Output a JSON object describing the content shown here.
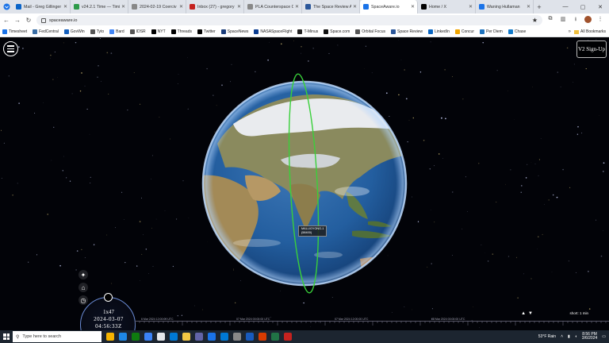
{
  "browser": {
    "tabs": [
      {
        "title": "Mail - Greg Gillinger",
        "color": "#0a64c8"
      },
      {
        "title": "v24.2.1 Time — Timi",
        "color": "#2e9b4a"
      },
      {
        "title": "2024-02-19 Coerciv",
        "color": "#888888"
      },
      {
        "title": "Inbox (27) - gregory",
        "color": "#c5221f"
      },
      {
        "title": "PLA Counterspace C",
        "color": "#888888"
      },
      {
        "title": "The Space Review A",
        "color": "#2b579a"
      },
      {
        "title": "SpaceAware.io",
        "color": "#1a73e8",
        "active": true
      },
      {
        "title": "Home / X",
        "color": "#000000"
      },
      {
        "title": "Waning Hullaman",
        "color": "#1a73e8"
      }
    ],
    "address": "spaceaware.io",
    "bookmarks": [
      {
        "label": "Timesheet",
        "color": "#1a73e8"
      },
      {
        "label": "FedCentral",
        "color": "#3a6ea5"
      },
      {
        "label": "GovWin",
        "color": "#1560bd"
      },
      {
        "label": "Tyto",
        "color": "#555555"
      },
      {
        "label": "Bard",
        "color": "#4285f4"
      },
      {
        "label": "IDSR",
        "color": "#555555"
      },
      {
        "label": "NYT",
        "color": "#000000"
      },
      {
        "label": "Threads",
        "color": "#000000"
      },
      {
        "label": "Twitter",
        "color": "#000000"
      },
      {
        "label": "SpaceNews",
        "color": "#1a3c7a"
      },
      {
        "label": "NASASpaceFlight",
        "color": "#0b3d91"
      },
      {
        "label": "T-Minus",
        "color": "#222222"
      },
      {
        "label": "Space.com",
        "color": "#111111"
      },
      {
        "label": "Orbital Focus",
        "color": "#555555"
      },
      {
        "label": "Space Review",
        "color": "#2b579a"
      },
      {
        "label": "LinkedIn",
        "color": "#0a66c2"
      },
      {
        "label": "Concur",
        "color": "#f0a500"
      },
      {
        "label": "Per Diem",
        "color": "#1e73be"
      },
      {
        "label": "Chase",
        "color": "#117aca"
      }
    ],
    "more_label": "»",
    "all_bookmarks_label": "All Bookmarks"
  },
  "app": {
    "signup_label": "V2 Sign-Up",
    "satellite_label": {
      "name": "MALLIGYONG-1",
      "id": "(58400)"
    },
    "orbit_color": "#39d03a",
    "clock": {
      "rate": "1x47",
      "date": "2024-03-07",
      "time": "04:56:33Z"
    },
    "timeline_dates": [
      "6 Mar 2024 12:00:00 UTC",
      "07 Mar 2024 00:00:00 UTC",
      "07 Mar 2024 12:00:00 UTC",
      "08 Mar 2024 00:00:00 UTC"
    ],
    "speed_label": "short: 1 min"
  },
  "taskbar": {
    "search_placeholder": "Type here to search",
    "weather": "53°F  Rain",
    "time": "8:56 PM",
    "date": "3/6/2024",
    "apps": [
      "#f5b400",
      "#1e88e5",
      "#0f7b0f",
      "#3b82f6",
      "#e5e7eb",
      "#0078d4",
      "#f2c744",
      "#6264a7",
      "#1a73e8",
      "#0078d4",
      "#888888",
      "#185abd",
      "#d83b01",
      "#217346",
      "#c5221f"
    ]
  }
}
